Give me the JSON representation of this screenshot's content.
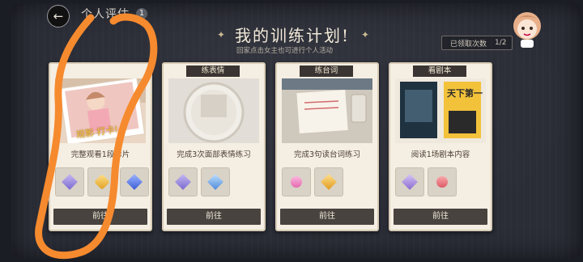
{
  "header": {
    "page_title": "个人评估",
    "badge": "1",
    "main_title": "我的训练计划!",
    "subtitle": "回家点击女主也可进行个人活动",
    "claimed_label": "已领取次数",
    "claimed_value": "1/2"
  },
  "cards": [
    {
      "tag": "",
      "task": "完整观看1段影片",
      "photo_caption": "观影 打卡!",
      "button": "前往"
    },
    {
      "tag": "练表情",
      "task": "完成3次面部表情练习",
      "photo_caption": "",
      "button": "前往"
    },
    {
      "tag": "练台词",
      "task": "完成3句读台词练习",
      "photo_caption": "",
      "button": "前往"
    },
    {
      "tag": "看剧本",
      "task": "阅读1场剧本内容",
      "photo_caption": "天下第一",
      "button": "前往"
    }
  ],
  "colors": {
    "card_bg": "#f5eee2",
    "button_bg": "#48433f",
    "scribble": "#f68a2e",
    "board": "#2a2c36"
  }
}
